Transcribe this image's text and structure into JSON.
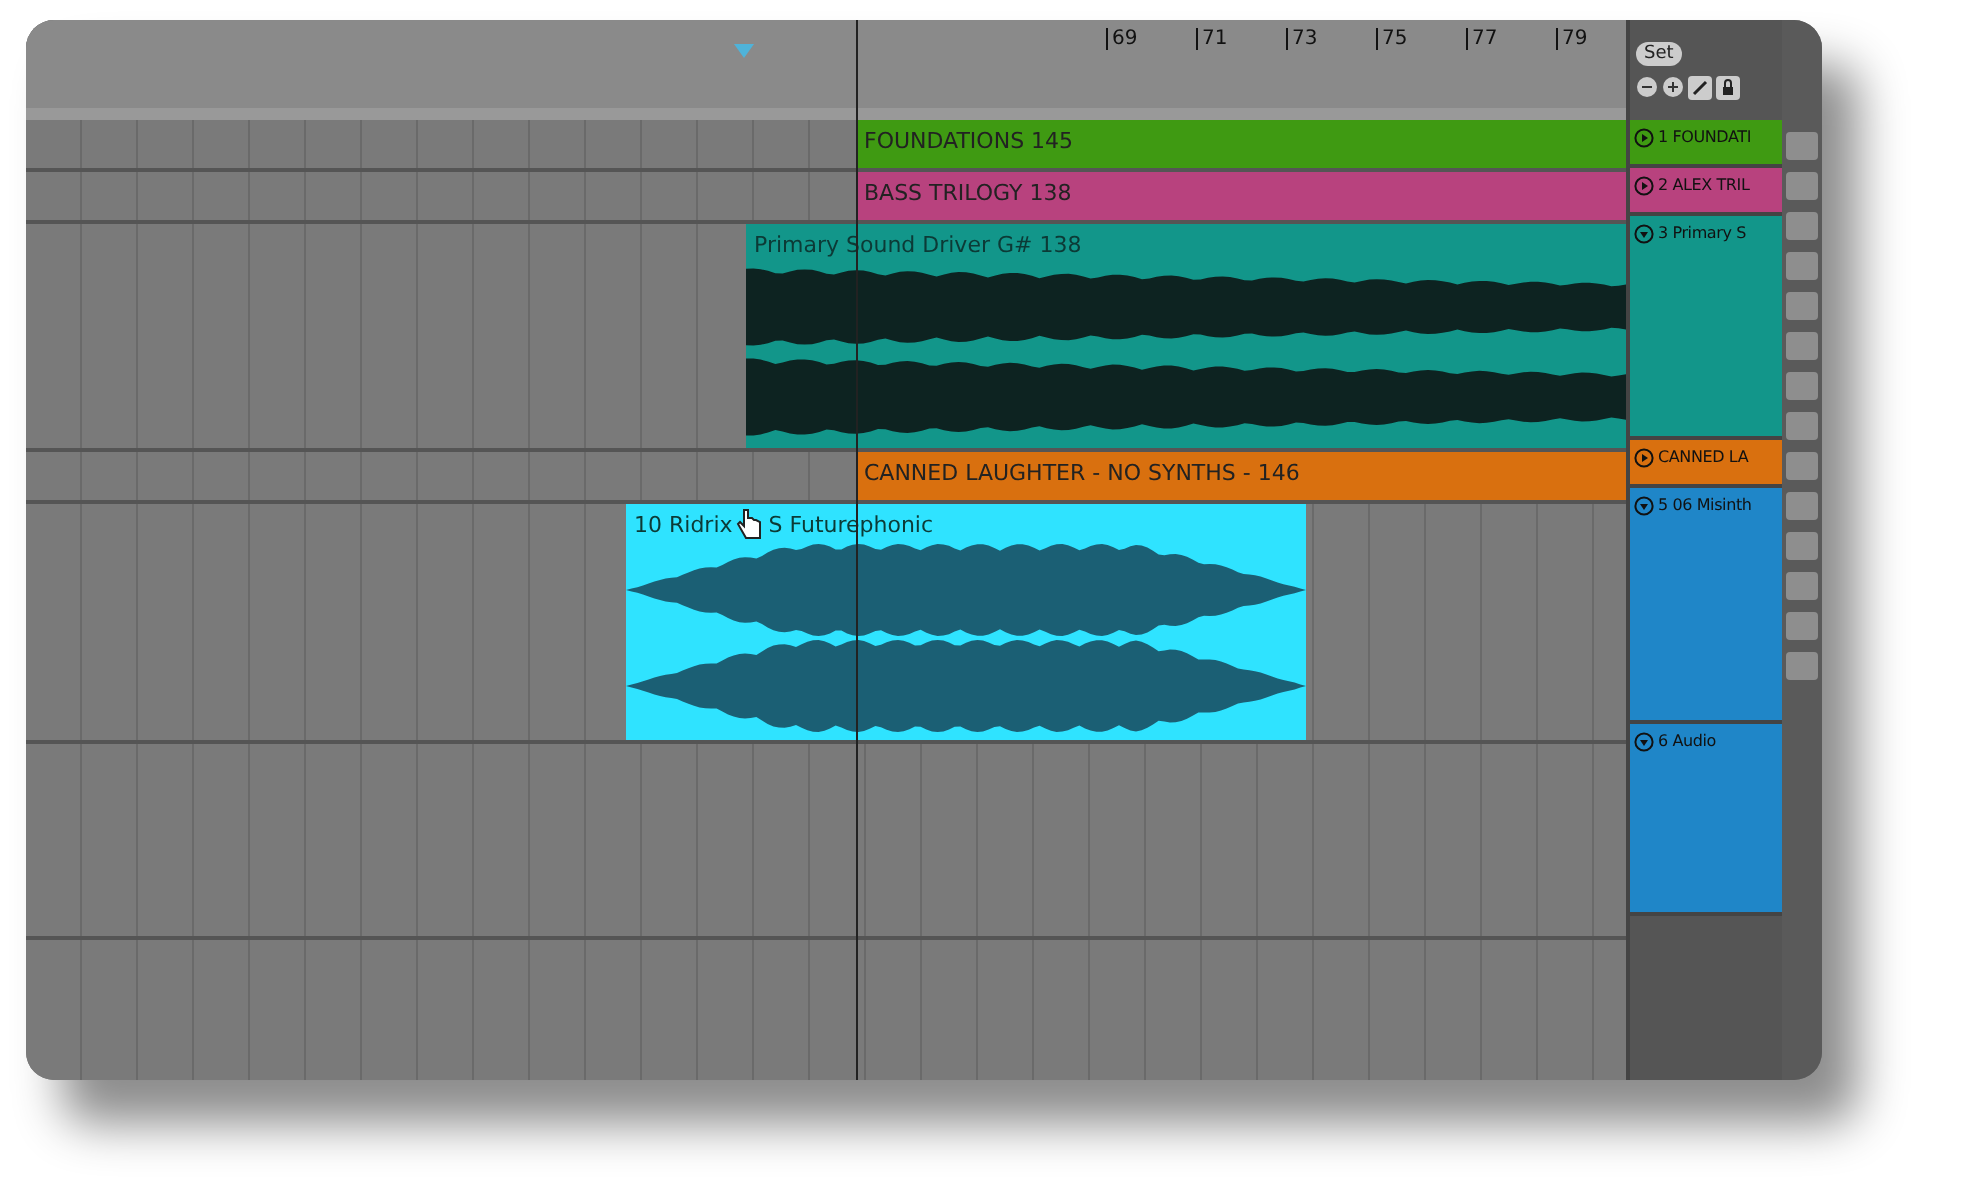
{
  "ruler": {
    "bars": [
      "69",
      "71",
      "73",
      "75",
      "77",
      "79"
    ]
  },
  "controls": {
    "set_button": "Set"
  },
  "tracks": [
    {
      "kind": "clip",
      "name": "1 FOUNDATI",
      "color": "#3f9a12",
      "expanded": false,
      "clip": {
        "title": "FOUNDATIONS 145"
      }
    },
    {
      "kind": "clip",
      "name": "2 ALEX TRIL",
      "color": "#b8427e",
      "expanded": false,
      "clip": {
        "title": "BASS TRILOGY 138"
      }
    },
    {
      "kind": "audio",
      "name": "3 Primary S",
      "color": "#12968a",
      "expanded": true,
      "clip": {
        "title": "Primary Sound Driver G# 138"
      }
    },
    {
      "kind": "clip",
      "name": "CANNED LA",
      "color": "#d9700f",
      "expanded": false,
      "clip": {
        "title": "CANNED LAUGHTER - NO SYNTHS - 146"
      }
    },
    {
      "kind": "audio",
      "name": "5 06 Misinth",
      "color": "#1f86c8",
      "expanded": true,
      "clip": {
        "title": "10 Ridrix",
        "title_after_cursor": "S Futurephonic",
        "color": "#2fe3ff"
      }
    },
    {
      "kind": "empty",
      "name": "6 Audio",
      "color": "#1f86c8",
      "expanded": true
    }
  ]
}
